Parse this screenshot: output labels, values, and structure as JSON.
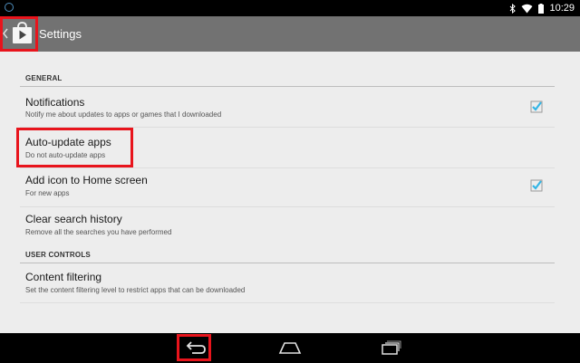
{
  "status_bar": {
    "time": "10:29"
  },
  "action_bar": {
    "title": "Settings",
    "app_icon": "play-store-icon",
    "up_icon": "chevron-left-icon"
  },
  "sections": [
    {
      "header": "GENERAL",
      "items": [
        {
          "title": "Notifications",
          "summary": "Notify me about updates to apps or games that I downloaded",
          "checked": true
        },
        {
          "title": "Auto-update apps",
          "summary": "Do not auto-update apps",
          "checked": null
        },
        {
          "title": "Add icon to Home screen",
          "summary": "For new apps",
          "checked": true
        },
        {
          "title": "Clear search history",
          "summary": "Remove all the searches you have performed",
          "checked": null
        }
      ]
    },
    {
      "header": "USER CONTROLS",
      "items": [
        {
          "title": "Content filtering",
          "summary": "Set the content filtering level to restrict apps that can be downloaded",
          "checked": null
        }
      ]
    }
  ],
  "navigation_bar": {
    "back_icon": "back-icon",
    "home_icon": "home-icon",
    "recents_icon": "recents-icon"
  },
  "colors": {
    "highlight": "#e8141c",
    "checkbox_accent": "#33b5e5",
    "action_bar": "#727272"
  }
}
